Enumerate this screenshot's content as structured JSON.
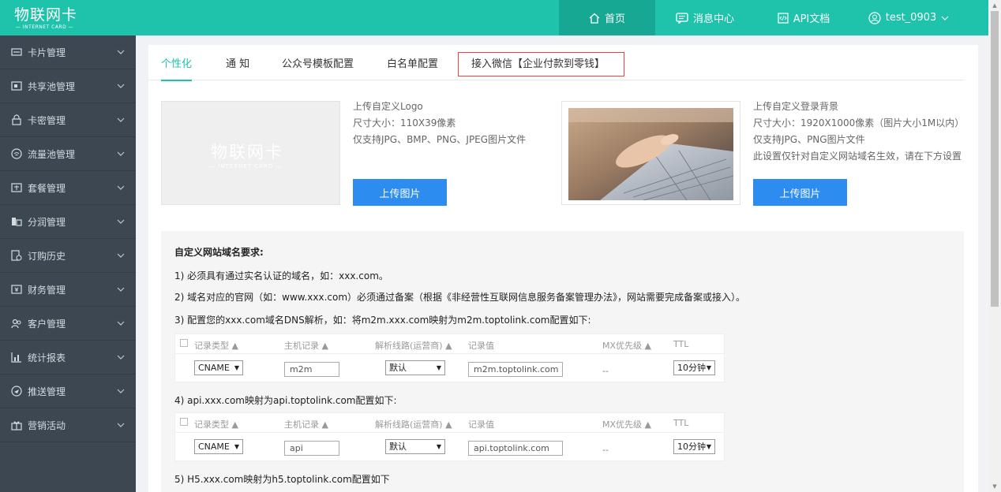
{
  "header": {
    "logo_title": "物联网卡",
    "logo_subtitle": "— INTERNET CARD —",
    "nav": {
      "home": "首页",
      "messages": "消息中心",
      "api_docs": "API文档",
      "user": "test_0903"
    }
  },
  "sidebar": {
    "items": [
      {
        "label": "卡片管理",
        "icon": "card-icon"
      },
      {
        "label": "共享池管理",
        "icon": "pool-icon"
      },
      {
        "label": "卡密管理",
        "icon": "lock-icon"
      },
      {
        "label": "流量池管理",
        "icon": "wifi-icon"
      },
      {
        "label": "套餐管理",
        "icon": "package-icon"
      },
      {
        "label": "分润管理",
        "icon": "profit-icon"
      },
      {
        "label": "订购历史",
        "icon": "history-icon"
      },
      {
        "label": "财务管理",
        "icon": "finance-icon"
      },
      {
        "label": "客户管理",
        "icon": "customer-icon"
      },
      {
        "label": "统计报表",
        "icon": "chart-icon"
      },
      {
        "label": "推送管理",
        "icon": "push-icon"
      },
      {
        "label": "营销活动",
        "icon": "gift-icon"
      }
    ]
  },
  "tabs": [
    "个性化",
    "通 知",
    "公众号模板配置",
    "白名单配置",
    "接入微信【企业付款到零钱】"
  ],
  "logo_upload": {
    "preview_title": "物联网卡",
    "preview_subtitle": "— INTERNET CARD —",
    "lines": [
      "上传自定义Logo",
      "尺寸大小：110X39像素",
      "仅支持JPG、BMP、PNG、JPEG图片文件"
    ],
    "button": "上传图片"
  },
  "bg_upload": {
    "lines": [
      "上传自定义登录背景",
      "尺寸大小：1920X1000像素（图片大小1M以内）",
      "仅支持JPG、PNG图片文件",
      "此设置仅针对自定义网站域名生效，请在下方设置"
    ],
    "button": "上传图片"
  },
  "requirements": {
    "title": "自定义网站域名要求:",
    "line1": "1) 必须具有通过实名认证的域名，如：xxx.com。",
    "line2": "2) 域名对应的官网（如：www.xxx.com）必须通过备案（根据《非经营性互联网信息服务备案管理办法》，网站需要完成备案或接入）。",
    "line3": "3) 配置您的xxx.com域名DNS解析，如：将m2m.xxx.com映射为m2m.toptolink.com配置如下:",
    "line4": "4) api.xxx.com映射为api.toptolink.com配置如下:",
    "line5": "5) H5.xxx.com映射为h5.toptolink.com配置如下"
  },
  "dns_headers": [
    "记录类型 ▲",
    "主机记录 ▲",
    "解析线路(运营商) ▲",
    "记录值",
    "MX优先级 ▲",
    "TTL"
  ],
  "dns_rows": [
    {
      "type": "CNAME",
      "host": "m2m",
      "line": "默认",
      "value": "m2m.toptolink.com",
      "mx": "--",
      "ttl": "10分钟"
    },
    {
      "type": "CNAME",
      "host": "api",
      "line": "默认",
      "value": "api.toptolink.com",
      "mx": "--",
      "ttl": "10分钟"
    }
  ]
}
